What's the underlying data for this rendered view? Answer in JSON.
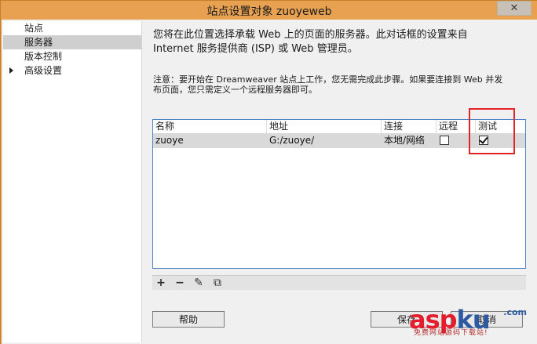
{
  "window": {
    "title": "站点设置对象 zuoyeweb",
    "close_glyph": "✕"
  },
  "sidebar": {
    "items": [
      {
        "label": "站点",
        "selected": false,
        "expandable": false
      },
      {
        "label": "服务器",
        "selected": true,
        "expandable": false
      },
      {
        "label": "版本控制",
        "selected": false,
        "expandable": false
      },
      {
        "label": "高级设置",
        "selected": false,
        "expandable": true
      }
    ]
  },
  "main": {
    "intro_line1": "您将在此位置选择承载 Web 上的页面的服务器。此对话框的设置来自",
    "intro_line2": "Internet 服务提供商 (ISP) 或 Web 管理员。",
    "note_line1": "注意：要开始在 Dreamweaver 站点上工作，您无需完成此步骤。如果要连接到 Web 并发",
    "note_line2": "布页面，您只需定义一个远程服务器即可。"
  },
  "server_table": {
    "columns": [
      "名称",
      "地址",
      "连接",
      "远程",
      "测试"
    ],
    "rows": [
      {
        "name": "zuoye",
        "address": "G:/zuoye/",
        "connection": "本地/网络",
        "remote": false,
        "test": true
      }
    ]
  },
  "toolbar": {
    "add_glyph": "+",
    "remove_glyph": "−",
    "edit_glyph": "✎",
    "duplicate_glyph": "⧉"
  },
  "buttons": {
    "help": "帮助",
    "save": "保存",
    "cancel": "取消"
  },
  "watermark": {
    "asp": "asp",
    "ku": "ku",
    "net": ".com",
    "subtitle": "免费网站源码下载站!"
  },
  "colors": {
    "titlebar": "#e8a150",
    "selection": "#cfcfcf",
    "highlight_box": "#e52226",
    "table_border": "#4e84c8"
  }
}
